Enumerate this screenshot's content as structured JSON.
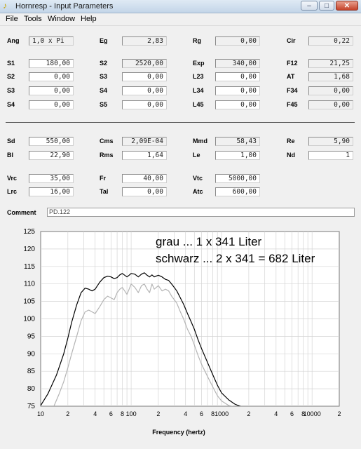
{
  "window": {
    "title": "Hornresp - Input Parameters",
    "controls": {
      "minimize": "–",
      "maximize": "□",
      "close": "✕"
    }
  },
  "menu": [
    "File",
    "Tools",
    "Window",
    "Help"
  ],
  "params": {
    "Ang": "1,0 x Pi",
    "Eg": "2,83",
    "Rg": "0,00",
    "Cir": "0,22",
    "S1": "180,00",
    "S2": "2520,00",
    "Exp": "340,00",
    "F12": "21,25",
    "S2b": "0,00",
    "S3": "0,00",
    "L23": "0,00",
    "AT": "1,68",
    "S3b": "0,00",
    "S4": "0,00",
    "L34": "0,00",
    "F34": "0,00",
    "S4b": "0,00",
    "S5": "0,00",
    "L45": "0,00",
    "F45": "0,00",
    "Sd": "550,00",
    "Cms": "2,09E-04",
    "Mmd": "58,43",
    "Re": "5,90",
    "Bl": "22,90",
    "Rms": "1,64",
    "Le": "1,00",
    "Nd": "1",
    "Vrc": "35,00",
    "Fr": "40,00",
    "Vtc": "5000,00",
    "Lrc": "16,00",
    "Tal": "0,00",
    "Atc": "600,00"
  },
  "labels": {
    "Ang": "Ang",
    "Eg": "Eg",
    "Rg": "Rg",
    "Cir": "Cir",
    "S1": "S1",
    "S2": "S2",
    "Exp": "Exp",
    "F12": "F12",
    "S2b": "S2",
    "S3": "S3",
    "L23": "L23",
    "AT": "AT",
    "S3b": "S3",
    "S4": "S4",
    "L34": "L34",
    "F34": "F34",
    "S4b": "S4",
    "S5": "S5",
    "L45": "L45",
    "F45": "F45",
    "Sd": "Sd",
    "Cms": "Cms",
    "Mmd": "Mmd",
    "Re": "Re",
    "Bl": "Bl",
    "Rms": "Rms",
    "Le": "Le",
    "Nd": "Nd",
    "Vrc": "Vrc",
    "Fr": "Fr",
    "Vtc": "Vtc",
    "Lrc": "Lrc",
    "Tal": "Tal",
    "Atc": "Atc",
    "Comment": "Comment"
  },
  "comment": "PD.122",
  "chart_data": {
    "type": "line",
    "xlabel": "Frequency (hertz)",
    "ylabel": "",
    "x_scale": "log",
    "xlim": [
      10,
      20000
    ],
    "ylim": [
      75,
      125
    ],
    "y_ticks": [
      75,
      80,
      85,
      90,
      95,
      100,
      105,
      110,
      115,
      120,
      125
    ],
    "x_tick_labels": [
      {
        "v": 10,
        "t": "10"
      },
      {
        "v": 20,
        "t": "2"
      },
      {
        "v": 40,
        "t": "4"
      },
      {
        "v": 60,
        "t": "6"
      },
      {
        "v": 80,
        "t": "8"
      },
      {
        "v": 100,
        "t": "100"
      },
      {
        "v": 200,
        "t": "2"
      },
      {
        "v": 400,
        "t": "4"
      },
      {
        "v": 600,
        "t": "6"
      },
      {
        "v": 800,
        "t": "8"
      },
      {
        "v": 1000,
        "t": "1000"
      },
      {
        "v": 2000,
        "t": "2"
      },
      {
        "v": 4000,
        "t": "4"
      },
      {
        "v": 6000,
        "t": "6"
      },
      {
        "v": 8000,
        "t": "8"
      },
      {
        "v": 10000,
        "t": "10000"
      },
      {
        "v": 20000,
        "t": "2"
      }
    ],
    "grid": true,
    "legend": [
      "grau ... 1 x 341 Liter",
      "schwarz ... 2 x 341 = 682 Liter"
    ],
    "series": [
      {
        "color": "#000000",
        "x": [
          10,
          12,
          15,
          18,
          20,
          22,
          25,
          28,
          31,
          34,
          37,
          40,
          45,
          50,
          55,
          60,
          65,
          70,
          75,
          80,
          85,
          90,
          95,
          100,
          110,
          120,
          130,
          140,
          150,
          160,
          170,
          180,
          200,
          220,
          240,
          260,
          280,
          300,
          320,
          350,
          380,
          420,
          460,
          500,
          550,
          600,
          700,
          800,
          900,
          1000,
          1200,
          1400,
          1600,
          1800
        ],
        "y": [
          75.2,
          78.5,
          84.0,
          90.0,
          94.5,
          99.0,
          104.0,
          107.5,
          108.8,
          108.5,
          108.0,
          108.5,
          110.5,
          111.8,
          112.2,
          112.0,
          111.5,
          111.8,
          112.6,
          113.0,
          112.5,
          112.0,
          112.5,
          113.0,
          112.8,
          112.0,
          112.8,
          113.2,
          112.5,
          112.0,
          112.6,
          112.0,
          112.5,
          112.0,
          111.3,
          111.0,
          110.0,
          109.0,
          108.0,
          106.0,
          104.2,
          101.5,
          99.2,
          97.0,
          94.0,
          91.5,
          87.5,
          84.0,
          81.0,
          78.8,
          76.8,
          75.6,
          75.0,
          74.5
        ]
      },
      {
        "color": "#b4b4b4",
        "x": [
          14,
          16,
          18,
          20,
          22,
          25,
          28,
          31,
          34,
          37,
          40,
          45,
          50,
          55,
          60,
          65,
          70,
          75,
          80,
          85,
          90,
          95,
          100,
          110,
          120,
          130,
          140,
          150,
          160,
          170,
          180,
          200,
          220,
          240,
          260,
          280,
          300,
          320,
          350,
          380,
          420,
          460,
          500,
          550,
          600,
          700,
          800,
          900,
          1000,
          1200,
          1400,
          1600,
          1800
        ],
        "y": [
          75.0,
          78.5,
          82.0,
          86.0,
          90.0,
          95.0,
          99.5,
          102.0,
          102.5,
          102.0,
          101.5,
          103.5,
          105.5,
          106.5,
          106.0,
          105.5,
          107.5,
          108.5,
          109.0,
          108.0,
          107.0,
          108.5,
          110.0,
          109.0,
          107.5,
          109.5,
          110.0,
          108.5,
          107.5,
          110.0,
          108.5,
          109.5,
          108.0,
          108.5,
          108.0,
          106.5,
          105.5,
          104.5,
          102.0,
          100.0,
          97.0,
          95.0,
          92.5,
          89.5,
          87.0,
          83.5,
          80.5,
          78.0,
          76.5,
          75.2,
          74.8,
          74.5,
          74.3
        ]
      }
    ]
  }
}
